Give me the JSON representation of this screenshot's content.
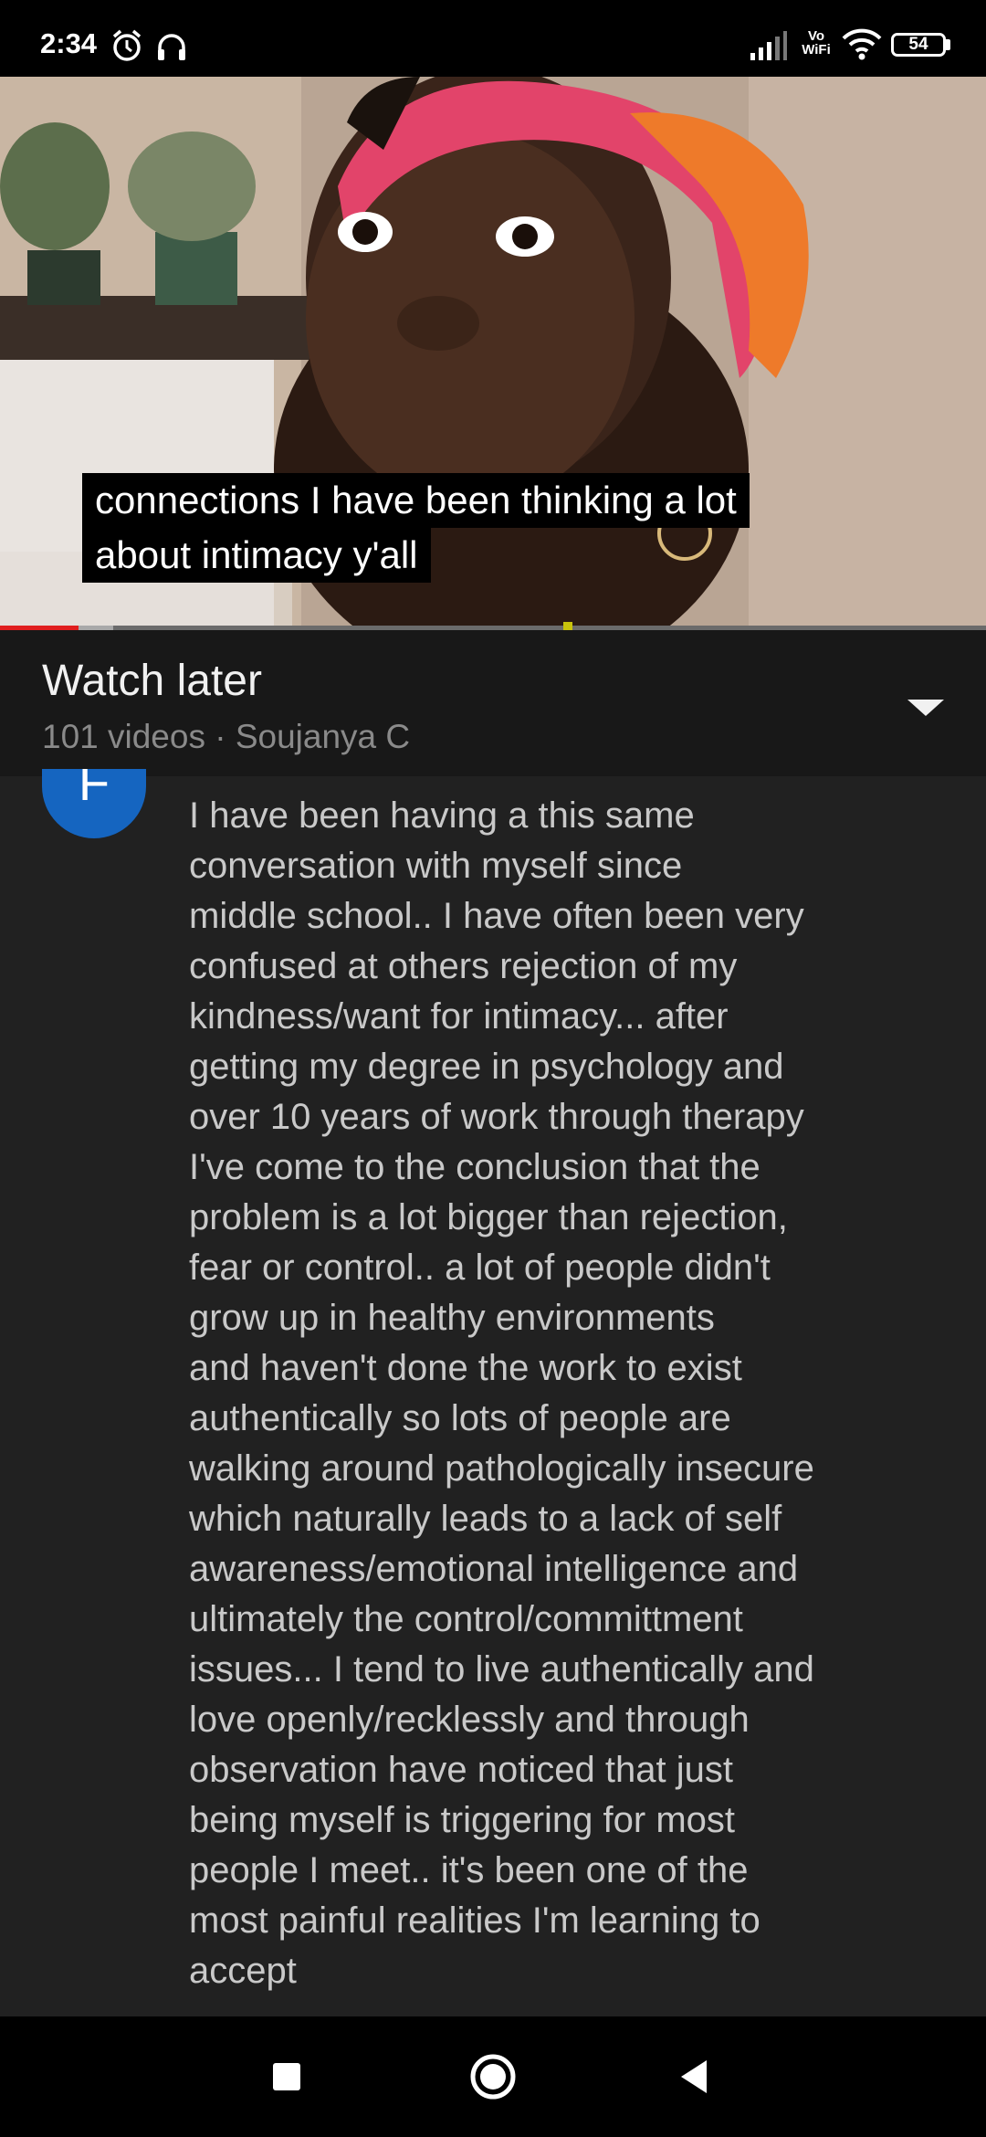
{
  "status_bar": {
    "time": "2:34",
    "icons": [
      "alarm-icon",
      "headset-icon",
      "signal-icon",
      "vowifi-icon",
      "wifi-icon",
      "battery-icon"
    ],
    "vowifi_top": "Vo",
    "vowifi_bottom": "WiFi",
    "battery": "54"
  },
  "video": {
    "caption_lines": [
      "connections I have been thinking a lot",
      "about intimacy y'all"
    ],
    "progress_played": 0.08,
    "colors": {
      "played": "#e01e1e",
      "buffered": "#a9a9a9",
      "marker": "#c9c30b"
    }
  },
  "playlist": {
    "title": "Watch later",
    "subtitle": "101 videos · Soujanya C",
    "toggle_icon": "chevron-down-icon"
  },
  "comment": {
    "avatar_letter": "F",
    "avatar_color": "#1565c0",
    "text": "I have been having a this same\nconversation with myself since\nmiddle school.. I have often been very\nconfused at others rejection of my\nkindness/want for intimacy... after\ngetting my degree in psychology and\nover 10 years of work through therapy\nI've come to the conclusion that the\nproblem is a lot bigger than rejection,\nfear or control.. a lot of people didn't\ngrow up in healthy environments\nand haven't done the work to exist\nauthentically so lots of people are\nwalking around pathologically insecure\nwhich naturally leads to a lack of self\nawareness/emotional intelligence and\nultimately the control/committment\nissues... I tend to live authentically and\nlove openly/recklessly and through\nobservation have noticed that just\nbeing myself is triggering for most\npeople I meet.. it's been one of the\nmost painful realities I'm learning to\naccept"
  },
  "nav_bar": {
    "buttons": [
      "recents-icon",
      "home-icon",
      "back-icon"
    ]
  }
}
